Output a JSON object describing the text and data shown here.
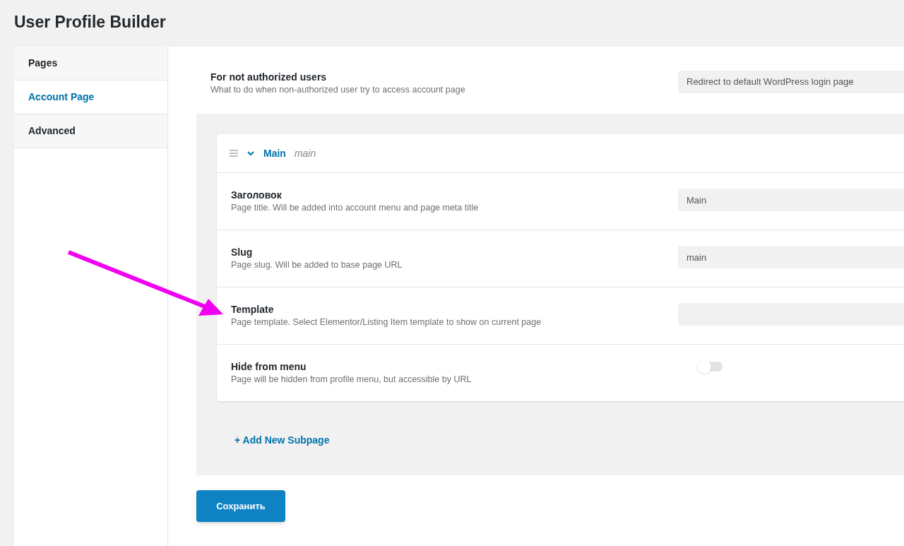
{
  "title": "User Profile Builder",
  "sidebar": {
    "items": [
      {
        "label": "Pages",
        "selected": false
      },
      {
        "label": "Account Page",
        "selected": true
      },
      {
        "label": "Advanced",
        "selected": false
      }
    ]
  },
  "setting": {
    "label": "For not authorized users",
    "description": "What to do when non-authorized user try to access account page",
    "value": "Redirect to default WordPress login page"
  },
  "subpage": {
    "expanded": true,
    "title": "Main",
    "slug": "main",
    "fields": [
      {
        "kind": "text",
        "label": "Заголовок",
        "description": "Page title. Will be added into account menu and page meta title",
        "value": "Main"
      },
      {
        "kind": "text",
        "label": "Slug",
        "description": "Page slug. Will be added to base page URL",
        "value": "main"
      },
      {
        "kind": "text",
        "label": "Template",
        "description": "Page template. Select Elementor/Listing Item template to show on current page"
      },
      {
        "kind": "toggle",
        "label": "Hide from menu",
        "description": "Page will be hidden from profile menu, but accessible by URL",
        "on": false
      }
    ]
  },
  "add_link": "+ Add New Subpage",
  "save_button": "Сохранить"
}
